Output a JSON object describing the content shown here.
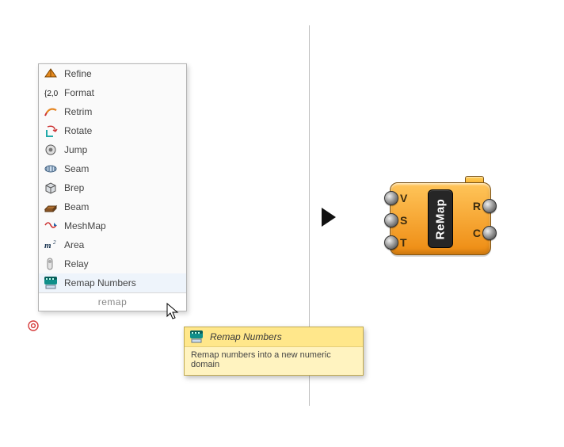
{
  "menu": {
    "items": [
      {
        "id": "refine",
        "label": "Refine",
        "icon": "refine-icon"
      },
      {
        "id": "format",
        "label": "Format",
        "icon": "format-icon"
      },
      {
        "id": "retrim",
        "label": "Retrim",
        "icon": "retrim-icon"
      },
      {
        "id": "rotate",
        "label": "Rotate",
        "icon": "rotate-icon"
      },
      {
        "id": "jump",
        "label": "Jump",
        "icon": "jump-icon"
      },
      {
        "id": "seam",
        "label": "Seam",
        "icon": "seam-icon"
      },
      {
        "id": "brep",
        "label": "Brep",
        "icon": "brep-icon"
      },
      {
        "id": "beam",
        "label": "Beam",
        "icon": "beam-icon"
      },
      {
        "id": "meshmap",
        "label": "MeshMap",
        "icon": "meshmap-icon"
      },
      {
        "id": "area",
        "label": "Area",
        "icon": "area-icon"
      },
      {
        "id": "relay",
        "label": "Relay",
        "icon": "relay-icon"
      },
      {
        "id": "remap",
        "label": "Remap Numbers",
        "icon": "remap-icon",
        "hover": true
      }
    ],
    "search_text": "remap"
  },
  "tooltip": {
    "title": "Remap Numbers",
    "body": "Remap numbers into a new numeric domain",
    "icon": "remap-icon"
  },
  "component": {
    "name": "ReMap",
    "inputs": [
      "V",
      "S",
      "T"
    ],
    "outputs": [
      "R",
      "C"
    ]
  },
  "colors": {
    "menu_border": "#b4b4b4",
    "tooltip_bg": "#ffe78b",
    "component_fill": "#f6a623",
    "component_dark": "#262626"
  }
}
